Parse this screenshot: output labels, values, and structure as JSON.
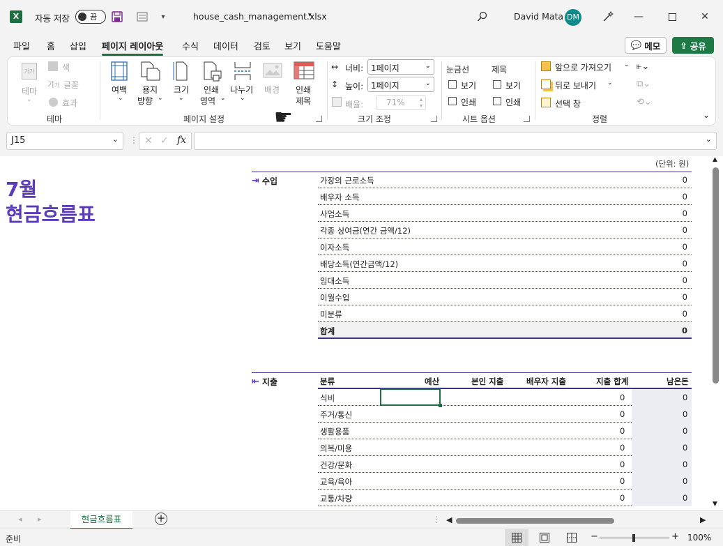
{
  "titlebar": {
    "autosave_label": "자동 저장",
    "toggle_state": "끔",
    "filename": "house_cash_management.xlsx",
    "user_name": "David Mata",
    "user_initials": "DM"
  },
  "tabs": [
    "파일",
    "홈",
    "삽입",
    "페이지 레이아웃",
    "수식",
    "데이터",
    "검토",
    "보기",
    "도움말"
  ],
  "active_tab": "페이지 레이아웃",
  "memo_label": "메모",
  "share_label": "공유",
  "ribbon": {
    "theme": {
      "themes_label": "테마",
      "colors_label": "색",
      "fonts_label": "글꼴",
      "effects_label": "효과",
      "group_label": "테마"
    },
    "page_setup": {
      "margins": "여백",
      "orientation_1": "용지",
      "orientation_2": "방향",
      "size": "크기",
      "print_area_1": "인쇄",
      "print_area_2": "영역",
      "breaks": "나누기",
      "background": "배경",
      "print_titles_1": "인쇄",
      "print_titles_2": "제목",
      "group_label": "페이지 설정"
    },
    "scale": {
      "width_label": "너비:",
      "width_value": "1페이지",
      "height_label": "높이:",
      "height_value": "1페이지",
      "scale_label": "배율:",
      "scale_value": "71%",
      "group_label": "크기 조정"
    },
    "sheet_options": {
      "gridlines": "눈금선",
      "headings": "제목",
      "view": "보기",
      "print": "인쇄",
      "group_label": "시트 옵션"
    },
    "arrange": {
      "bring_forward": "앞으로 가져오기",
      "send_backward": "뒤로 보내기",
      "selection_pane": "선택 창",
      "group_label": "정렬"
    }
  },
  "formula_bar": {
    "name_box": "J15",
    "formula": ""
  },
  "sheet": {
    "title_line1": "7월",
    "title_line2": "현금흐름표",
    "unit": "(단위: 원)",
    "income": {
      "label": "수입",
      "rows": [
        {
          "label": "가장의 근로소득",
          "value": "0"
        },
        {
          "label": "배우자 소득",
          "value": "0"
        },
        {
          "label": "사업소득",
          "value": "0"
        },
        {
          "label": "각종 상여금(연간 금액/12)",
          "value": "0"
        },
        {
          "label": "이자소득",
          "value": "0"
        },
        {
          "label": "배당소득(연간금액/12)",
          "value": "0"
        },
        {
          "label": "임대소득",
          "value": "0"
        },
        {
          "label": "이월수입",
          "value": "0"
        },
        {
          "label": "미분류",
          "value": "0"
        }
      ],
      "total_label": "합계",
      "total_value": "0"
    },
    "expense": {
      "label": "지출",
      "headers": {
        "category": "분류",
        "budget": "예산",
        "self": "본인 지출",
        "spouse": "배우자 지출",
        "total": "지출 합계",
        "remain": "남은돈"
      },
      "rows": [
        {
          "label": "식비",
          "total": "0",
          "remain": "0"
        },
        {
          "label": "주거/통신",
          "total": "0",
          "remain": "0"
        },
        {
          "label": "생활용품",
          "total": "0",
          "remain": "0"
        },
        {
          "label": "의복/미용",
          "total": "0",
          "remain": "0"
        },
        {
          "label": "건강/문화",
          "total": "0",
          "remain": "0"
        },
        {
          "label": "교육/육아",
          "total": "0",
          "remain": "0"
        },
        {
          "label": "교통/차량",
          "total": "0",
          "remain": "0"
        }
      ]
    }
  },
  "sheet_tab": "현금흐름표",
  "status": {
    "ready": "준비",
    "zoom": "100%"
  }
}
